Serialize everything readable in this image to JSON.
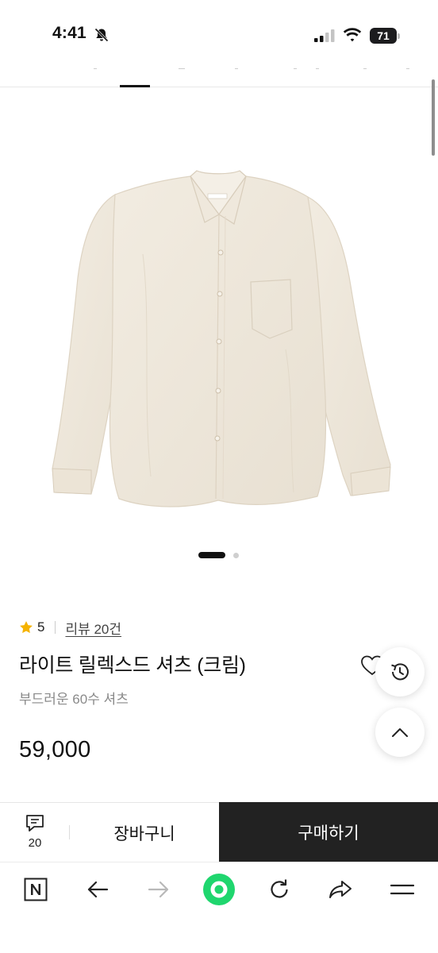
{
  "status_bar": {
    "time": "4:41",
    "battery": "71"
  },
  "product": {
    "rating": "5",
    "review_link": "리뷰 20건",
    "title": "라이트 릴렉스드 셔츠 (크림)",
    "subtitle": "부드러운 60수 셔츠",
    "price": "59,000",
    "image_color": "#efe8dc"
  },
  "carousel": {
    "current": 1,
    "total": 2
  },
  "purchase_bar": {
    "chat_count": "20",
    "cart_label": "장바구니",
    "buy_label": "구매하기"
  },
  "browser_toolbar": {
    "icons": [
      "naver-n-icon",
      "back-arrow-icon",
      "forward-arrow-icon",
      "green-dot-icon",
      "reload-icon",
      "share-icon",
      "menu-icon"
    ]
  },
  "colors": {
    "accent_green": "#1fd66e",
    "buy_button": "#222222",
    "star": "#f5b301"
  }
}
